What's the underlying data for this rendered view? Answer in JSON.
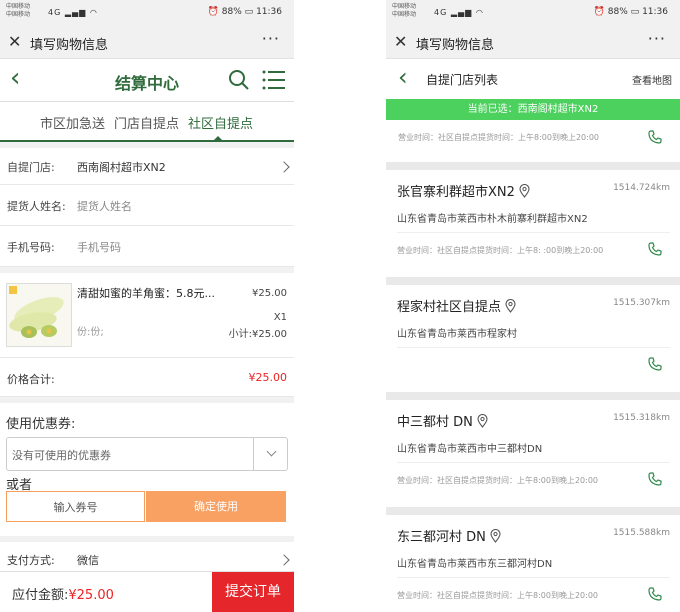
{
  "left": {
    "status": {
      "carrier1": "中国移动",
      "carrier2": "中国移动",
      "network": "4G",
      "battery": "88%",
      "time": "11:36"
    },
    "webview": {
      "title": "填写购物信息",
      "more": "···"
    },
    "header": {
      "title": "结算中心"
    },
    "tabs": [
      {
        "label": "市区加急送"
      },
      {
        "label": "门店自提点"
      },
      {
        "label": "社区自提点"
      }
    ],
    "store": {
      "label": "自提门店:",
      "value": "西南阁村超市XN2"
    },
    "name_field": {
      "label": "提货人姓名:",
      "placeholder": "提货人姓名"
    },
    "phone_field": {
      "label": "手机号码:",
      "placeholder": "手机号码"
    },
    "product": {
      "name": "清甜如蜜的羊角蜜：5.8元...",
      "price": "¥25.00",
      "spec": "份:份;",
      "qty": "X1",
      "subtotal": "小计:¥25.00"
    },
    "total": {
      "label": "价格合计:",
      "value": "¥25.00"
    },
    "coupon": {
      "label": "使用优惠券:",
      "select_value": "没有可使用的优惠券",
      "or_label": "或者",
      "code_placeholder": "输入券号",
      "confirm_label": "确定使用"
    },
    "payment": {
      "label": "支付方式:",
      "value": "微信"
    },
    "bottom": {
      "amount_label": "应付金额:",
      "amount": "¥25.00",
      "submit_label": "提交订单"
    }
  },
  "right": {
    "status": {
      "carrier1": "中国移动",
      "carrier2": "中国移动",
      "network": "4G",
      "battery": "88%",
      "time": "11:36"
    },
    "webview": {
      "title": "填写购物信息",
      "more": "···"
    },
    "header": {
      "title": "自提门店列表",
      "map_link": "查看地图"
    },
    "banner": "当前已选：西南阁村超市XN2",
    "top_hours": "营业时间：社区自提点提货时间：上午8:00到晚上20:00",
    "stores": [
      {
        "name": "张官寨利群超市XN2",
        "distance": "1514.724km",
        "address": "山东省青岛市莱西市朴木前寨利群超市XN2",
        "hours": "营业时间：社区自提点提货时间：上午8: :00到晚上20:00"
      },
      {
        "name": "程家村社区自提点",
        "distance": "1515.307km",
        "address": "山东省青岛市莱西市程家村",
        "hours": ""
      },
      {
        "name": "中三都村 DN",
        "distance": "1515.318km",
        "address": "山东省青岛市莱西市中三都村DN",
        "hours": "营业时间：社区自提点提货时间：上午8:00到晚上20:00"
      },
      {
        "name": "东三都河村 DN",
        "distance": "1515.588km",
        "address": "山东省青岛市莱西市东三都河村DN",
        "hours": "营业时间：社区自提点提货时间：上午8:00到晚上20:00"
      }
    ]
  }
}
